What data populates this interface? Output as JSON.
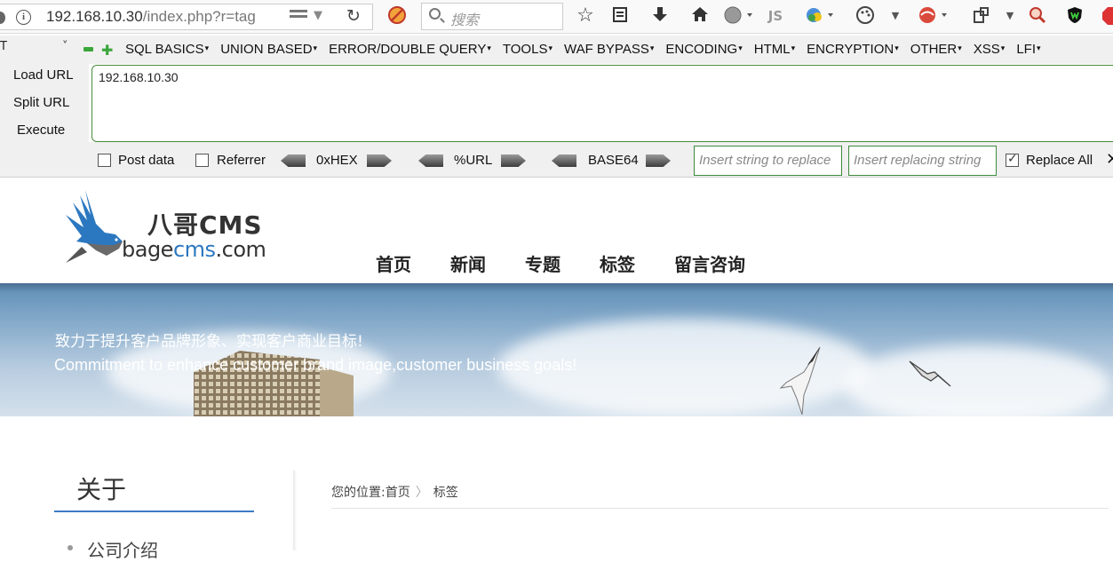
{
  "browser": {
    "url_host": "192.168.10.30",
    "url_path": "/index.php?r=tag",
    "search_placeholder": "搜索",
    "js_label": "JS"
  },
  "hackbar": {
    "menu_items": [
      "SQL BASICS",
      "UNION BASED",
      "ERROR/DOUBLE QUERY",
      "TOOLS",
      "WAF BYPASS",
      "ENCODING",
      "HTML",
      "ENCRYPTION",
      "OTHER",
      "XSS",
      "LFI"
    ],
    "select_value": "T",
    "load_url": "Load URL",
    "split_url": "Split URL",
    "execute": "Execute",
    "url_value": "192.168.10.30",
    "post_data": "Post data",
    "referrer": "Referrer",
    "hex": "0xHEX",
    "url_enc": "%URL",
    "base64": "BASE64",
    "replace_placeholder": "Insert string to replace",
    "replacing_placeholder": "Insert replacing string",
    "replace_all": "Replace All",
    "post_checked": false,
    "referrer_checked": false,
    "replace_all_checked": true
  },
  "site": {
    "logo_cn": "八哥CMS",
    "logo_en_a": "bage",
    "logo_en_b": "cms",
    "logo_en_c": ".com",
    "nav": [
      "首页",
      "新闻",
      "专题",
      "标签",
      "留言咨询"
    ],
    "banner_cn": "致力于提升客户品牌形象、实现客户商业目标!",
    "banner_en": "Commitment to enhance customer brand image,customer business goals!",
    "sidebar_title": "关于",
    "sidebar_first_item": "公司介绍",
    "breadcrumb_prefix": "您的位置:",
    "breadcrumb_home": "首页",
    "breadcrumb_sep": "〉",
    "breadcrumb_current": "标签"
  },
  "colors": {
    "accent": "#2c78c0",
    "hackbar_green": "#3d8a3d"
  }
}
